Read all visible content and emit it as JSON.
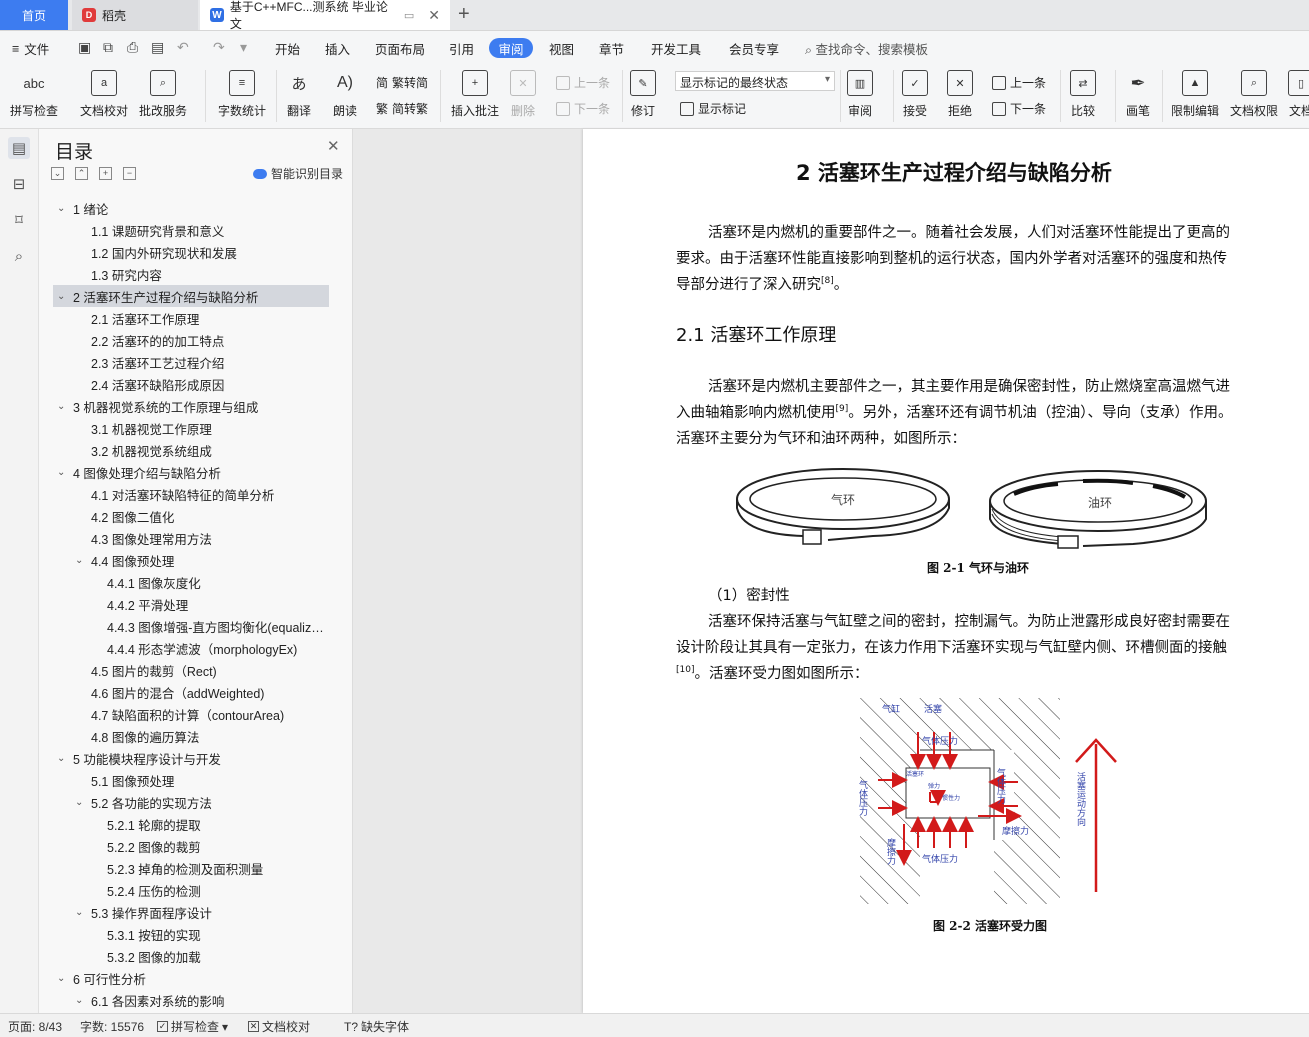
{
  "tabs": {
    "home": "首页",
    "daoke": "稻壳",
    "doc": "基于C++MFC...测系统 毕业论文"
  },
  "menu": {
    "file": "文件",
    "items": [
      "开始",
      "插入",
      "页面布局",
      "引用",
      "审阅",
      "视图",
      "章节",
      "开发工具",
      "会员专享"
    ],
    "active": "审阅",
    "search": "查找命令、搜索模板"
  },
  "ribbon": {
    "spell": "拼写检查",
    "proofread": "文档校对",
    "batch": "批改服务",
    "wordcount": "字数统计",
    "translate": "翻译",
    "read": "朗读",
    "trad": "繁转简",
    "simp": "简转繁",
    "insert_comment": "插入批注",
    "delete": "删除",
    "prev": "上一条",
    "next": "下一条",
    "revise": "修订",
    "markup_state": "显示标记的最终状态",
    "show_markup": "显示标记",
    "review": "审阅",
    "accept": "接受",
    "reject": "拒绝",
    "prev2": "上一条",
    "next2": "下一条",
    "compare": "比较",
    "pen": "画笔",
    "restrict": "限制编辑",
    "perm": "文档权限",
    "doc": "文档"
  },
  "toc": {
    "title": "目录",
    "smart": "智能识别目录",
    "items": [
      {
        "level": 1,
        "caret": "v",
        "text": "1  绪论"
      },
      {
        "level": 2,
        "text": "1.1  课题研究背景和意义"
      },
      {
        "level": 2,
        "text": "1.2 国内外研究现状和发展"
      },
      {
        "level": 2,
        "text": "1.3 研究内容"
      },
      {
        "level": 1,
        "caret": "v",
        "text": "2  活塞环生产过程介绍与缺陷分析",
        "selected": true
      },
      {
        "level": 2,
        "text": "2.1 活塞环工作原理"
      },
      {
        "level": 2,
        "text": "2.2 活塞环的的加工特点"
      },
      {
        "level": 2,
        "text": "2.3 活塞环工艺过程介绍"
      },
      {
        "level": 2,
        "text": "2.4 活塞环缺陷形成原因"
      },
      {
        "level": 1,
        "caret": "v",
        "text": "3  机器视觉系统的工作原理与组成"
      },
      {
        "level": 2,
        "text": "3.1 机器视觉工作原理"
      },
      {
        "level": 2,
        "text": "3.2 机器视觉系统组成"
      },
      {
        "level": 1,
        "caret": "v",
        "text": "4  图像处理介绍与缺陷分析"
      },
      {
        "level": 2,
        "text": "4.1 对活塞环缺陷特征的简单分析"
      },
      {
        "level": 2,
        "text": "4.2 图像二值化"
      },
      {
        "level": 2,
        "text": "4.3 图像处理常用方法"
      },
      {
        "level": 2,
        "caret": "v",
        "text": "4.4 图像预处理"
      },
      {
        "level": 3,
        "text": "4.4.1 图像灰度化"
      },
      {
        "level": 3,
        "text": "4.4.2 平滑处理"
      },
      {
        "level": 3,
        "text": "4.4.3 图像增强-直方图均衡化(equaliz…"
      },
      {
        "level": 3,
        "text": "4.4.4 形态学滤波（morphologyEx)"
      },
      {
        "level": 2,
        "text": "4.5 图片的裁剪（Rect)"
      },
      {
        "level": 2,
        "text": "4.6 图片的混合（addWeighted)"
      },
      {
        "level": 2,
        "text": "4.7 缺陷面积的计算（contourArea)"
      },
      {
        "level": 2,
        "text": "4.8 图像的遍历算法"
      },
      {
        "level": 1,
        "caret": "v",
        "text": "5  功能模块程序设计与开发"
      },
      {
        "level": 2,
        "text": "5.1 图像预处理"
      },
      {
        "level": 2,
        "caret": "v",
        "text": "5.2 各功能的实现方法"
      },
      {
        "level": 3,
        "text": "5.2.1 轮廓的提取"
      },
      {
        "level": 3,
        "text": "5.2.2 图像的裁剪"
      },
      {
        "level": 3,
        "text": "5.2.3 掉角的检测及面积测量"
      },
      {
        "level": 3,
        "text": "5.2.4 压伤的检测"
      },
      {
        "level": 2,
        "caret": "v",
        "text": "5.3 操作界面程序设计"
      },
      {
        "level": 3,
        "text": "5.3.1 按钮的实现"
      },
      {
        "level": 3,
        "text": "5.3.2 图像的加载"
      },
      {
        "level": 1,
        "caret": "v",
        "text": "6  可行性分析"
      },
      {
        "level": 2,
        "caret": "v",
        "text": "6.1 各因素对系统的影响"
      }
    ]
  },
  "doc": {
    "h1": "2  活塞环生产过程介绍与缺陷分析",
    "p1": [
      "活塞环是内燃机的重要部件之一。随着社会发展，人们对活塞环性能提出了更高的",
      "要求。由于活塞环性能直接影响到整机的运行状态，国内外学者对活塞环的强度和热传",
      "导部分进行了深入研究"
    ],
    "ref8": "[8]",
    "p1_end": "。",
    "h2": "2.1 活塞环工作原理",
    "p2_1": "活塞环是内燃机主要部件之一，其主要作用是确保密封性，防止燃烧室高温燃气进",
    "p2_2a": "入曲轴箱影响内燃机使用",
    "ref9": "[9]",
    "p2_2b": "。另外，活塞环还有调节机油（控油）、导向（支承）作用。",
    "p2_3": "活塞环主要分为气环和油环两种，如图所示：",
    "ring1": "气环",
    "ring2": "油环",
    "fig1": "图 2-1  气环与油环",
    "sub1": "（1）密封性",
    "p3_1": "活塞环保持活塞与气缸壁之间的密封，控制漏气。为防止泄露形成良好密封需要在",
    "p3_2": "设计阶段让其具有一定张力，在该力作用下活塞环实现与气缸壁内侧、环槽侧面的接触",
    "ref10": "[10]",
    "p3_3": "。活塞环受力图如图所示：",
    "fig2": "图 2-2  活塞环受力图",
    "diagram": {
      "cylinder": "气缸",
      "piston": "活塞",
      "gas_top": "气体压力",
      "gas_bottom": "气体压力",
      "gas_left": "气体压力",
      "gas_right": "气体压力",
      "ring": "活塞环",
      "elastic": "弹力",
      "inertia": "惯性力",
      "friction_r": "摩擦力",
      "friction_l": "摩擦力",
      "motion": "活塞运动方向"
    }
  },
  "status": {
    "page": "页面: 8/43",
    "words": "字数: 15576",
    "spell": "拼写检查",
    "proof": "文档校对",
    "missing_font": "缺失字体"
  }
}
